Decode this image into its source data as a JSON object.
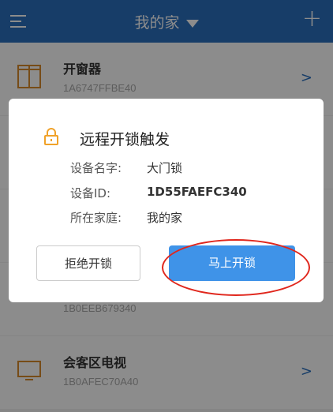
{
  "header": {
    "title": "我的家"
  },
  "devices": [
    {
      "name": "开窗器",
      "id": "1A6747FFBE40"
    },
    {
      "name": "",
      "id": ""
    },
    {
      "name": "",
      "id": ""
    },
    {
      "name": "",
      "id": "1B0EEB679340"
    },
    {
      "name": "会客区电视",
      "id": "1B0AFEC70A40"
    }
  ],
  "dialog": {
    "title": "远程开锁触发",
    "device_name_label": "设备名字:",
    "device_name": "大门锁",
    "device_id_label": "设备ID:",
    "device_id": "1D55FAEFC340",
    "home_label": "所在家庭:",
    "home": "我的家",
    "reject_label": "拒绝开锁",
    "accept_label": "马上开锁"
  },
  "colors": {
    "header": "#2a6fbd",
    "accent": "#3f93e8",
    "highlight": "#e0261c",
    "lock": "#f0a22a",
    "device_icon": "#d98a2b"
  }
}
